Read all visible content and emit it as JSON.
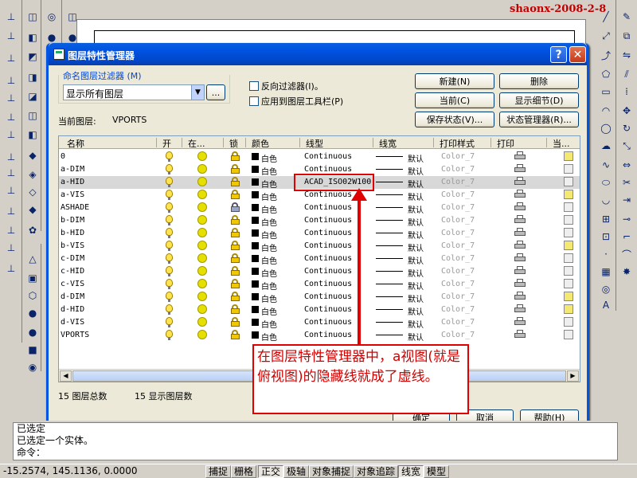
{
  "watermark": "shaonx-2008-2-8",
  "dialog": {
    "title": "图层特性管理器",
    "help_button": "?",
    "close_button": "✕",
    "filter_group_label": "命名图层过滤器 (M)",
    "filter_value": "显示所有图层",
    "filter_browse": "...",
    "invert_filter": "反向过滤器(I)。",
    "apply_toolbar": "应用到图层工具栏(P)",
    "current_layer_label": "当前图层:",
    "current_layer_value": "VPORTS",
    "buttons": {
      "new": "新建(N)",
      "delete": "删除",
      "current": "当前(C)",
      "show_details": "显示细节(D)",
      "save_state": "保存状态(V)...",
      "state_manager": "状态管理器(R)..."
    },
    "columns": [
      "名称",
      "开",
      "在...",
      "锁",
      "颜色",
      "线型",
      "线宽",
      "打印样式",
      "打印",
      "当..."
    ],
    "layers": [
      {
        "name": "0",
        "color": "白色",
        "linetype": "Continuous",
        "lineweight": "默认",
        "plot_style": "Color_7",
        "locked": false,
        "freeze_y": true
      },
      {
        "name": "a-DIM",
        "color": "白色",
        "linetype": "Continuous",
        "lineweight": "默认",
        "plot_style": "Color_7",
        "locked": false,
        "freeze_y": false
      },
      {
        "name": "a-HID",
        "color": "白色",
        "linetype": "ACAD_ISO02W100",
        "lineweight": "默认",
        "plot_style": "Color_7",
        "locked": false,
        "freeze_y": false,
        "selected": true
      },
      {
        "name": "a-VIS",
        "color": "白色",
        "linetype": "Continuous",
        "lineweight": "默认",
        "plot_style": "Color_7",
        "locked": false,
        "freeze_y": true
      },
      {
        "name": "ASHADE",
        "color": "白色",
        "linetype": "Continuous",
        "lineweight": "默认",
        "plot_style": "Color_7",
        "locked": true,
        "freeze_y": false
      },
      {
        "name": "b-DIM",
        "color": "白色",
        "linetype": "Continuous",
        "lineweight": "默认",
        "plot_style": "Color_7",
        "locked": false,
        "freeze_y": false
      },
      {
        "name": "b-HID",
        "color": "白色",
        "linetype": "Continuous",
        "lineweight": "默认",
        "plot_style": "Color_7",
        "locked": false,
        "freeze_y": false
      },
      {
        "name": "b-VIS",
        "color": "白色",
        "linetype": "Continuous",
        "lineweight": "默认",
        "plot_style": "Color_7",
        "locked": false,
        "freeze_y": true
      },
      {
        "name": "c-DIM",
        "color": "白色",
        "linetype": "Continuous",
        "lineweight": "默认",
        "plot_style": "Color_7",
        "locked": false,
        "freeze_y": false
      },
      {
        "name": "c-HID",
        "color": "白色",
        "linetype": "Continuous",
        "lineweight": "默认",
        "plot_style": "Color_7",
        "locked": false,
        "freeze_y": false
      },
      {
        "name": "c-VIS",
        "color": "白色",
        "linetype": "Continuous",
        "lineweight": "默认",
        "plot_style": "Color_7",
        "locked": false,
        "freeze_y": false
      },
      {
        "name": "d-DIM",
        "color": "白色",
        "linetype": "Continuous",
        "lineweight": "默认",
        "plot_style": "Color_7",
        "locked": false,
        "freeze_y": true
      },
      {
        "name": "d-HID",
        "color": "白色",
        "linetype": "Continuous",
        "lineweight": "默认",
        "plot_style": "Color_7",
        "locked": false,
        "freeze_y": true
      },
      {
        "name": "d-VIS",
        "color": "白色",
        "linetype": "Continuous",
        "lineweight": "默认",
        "plot_style": "Color_7",
        "locked": false,
        "freeze_y": false
      },
      {
        "name": "VPORTS",
        "color": "白色",
        "linetype": "Continuous",
        "lineweight": "默认",
        "plot_style": "Color_7",
        "locked": false,
        "freeze_y": false
      }
    ],
    "summary_total": "15 图层总数",
    "summary_shown": "15 显示图层数",
    "ok": "确定",
    "cancel": "取消",
    "help": "帮助(H)"
  },
  "annotation": "在图层特性管理器中，a视图(就是俯视图)的隐藏线就成了虚线。",
  "command_lines": [
    "已选定",
    "已选定一个实体。",
    "命令："
  ],
  "status": {
    "coords": "-15.2574, 145.1136, 0.0000",
    "toggles": [
      "捕捉",
      "栅格",
      "正交",
      "极轴",
      "对象捕捉",
      "对象追踪",
      "线宽",
      "模型"
    ]
  },
  "colors": {
    "accent": "#0054e3",
    "annotation": "#e00000",
    "selected_row": "#d8d8d8"
  }
}
